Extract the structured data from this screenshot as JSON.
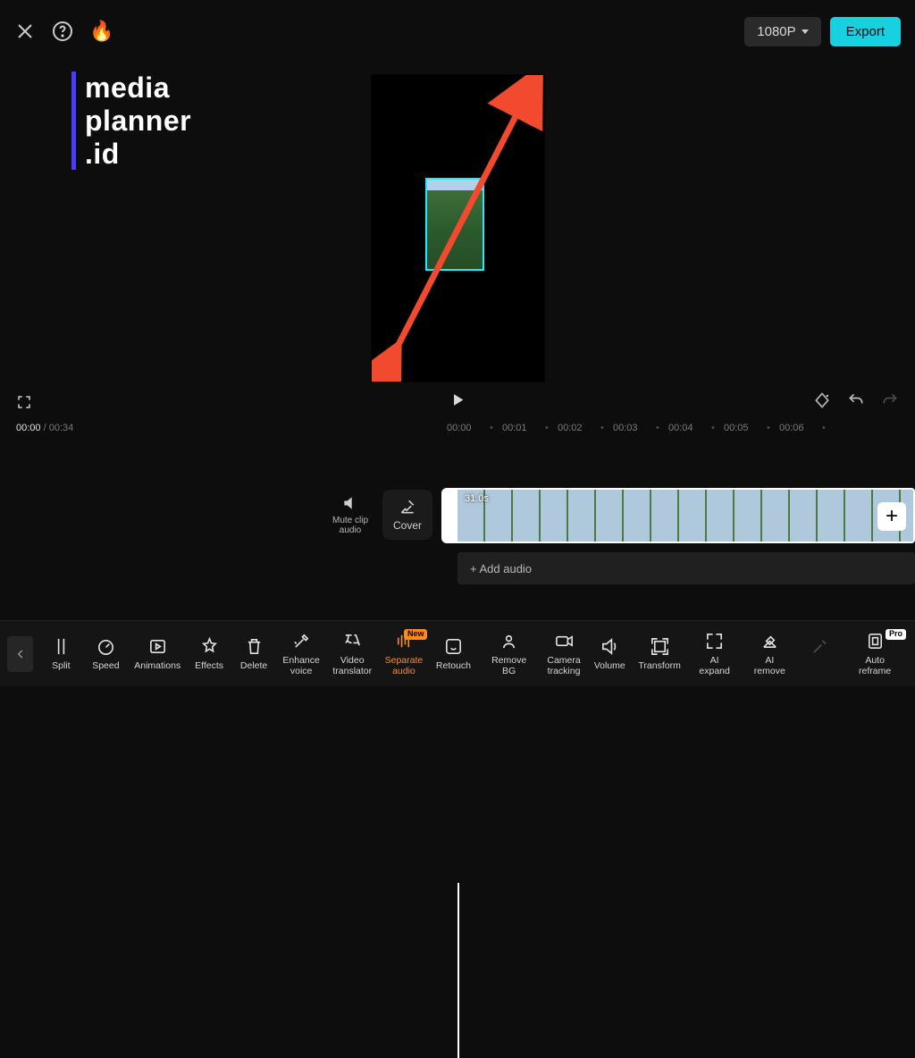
{
  "topbar": {
    "resolution": "1080P",
    "export": "Export"
  },
  "watermark": {
    "line1": "media",
    "line2": "planner",
    "line3": ".id"
  },
  "preview": {
    "current_time": "00:00",
    "total_time": "00:34"
  },
  "ruler": [
    "00:00",
    "00:01",
    "00:02",
    "00:03",
    "00:04",
    "00:05",
    "00:06"
  ],
  "clip": {
    "mute_label": "Mute clip audio",
    "cover_label": "Cover",
    "duration": "31.0s",
    "add_audio": "+ Add audio"
  },
  "tools": {
    "split": "Split",
    "speed": "Speed",
    "animations": "Animations",
    "effects": "Effects",
    "delete": "Delete",
    "enhance_voice_l1": "Enhance",
    "enhance_voice_l2": "voice",
    "video_translator_l1": "Video",
    "video_translator_l2": "translator",
    "separate_audio_l1": "Separate",
    "separate_audio_l2": "audio",
    "retouch": "Retouch",
    "remove_bg": "Remove BG",
    "camera_tracking_l1": "Camera",
    "camera_tracking_l2": "tracking",
    "volume": "Volume",
    "transform": "Transform",
    "ai_expand": "AI expand",
    "ai_remove": "AI remove",
    "auto_reframe": "Auto reframe"
  },
  "badges": {
    "new": "New",
    "pro": "Pro"
  }
}
